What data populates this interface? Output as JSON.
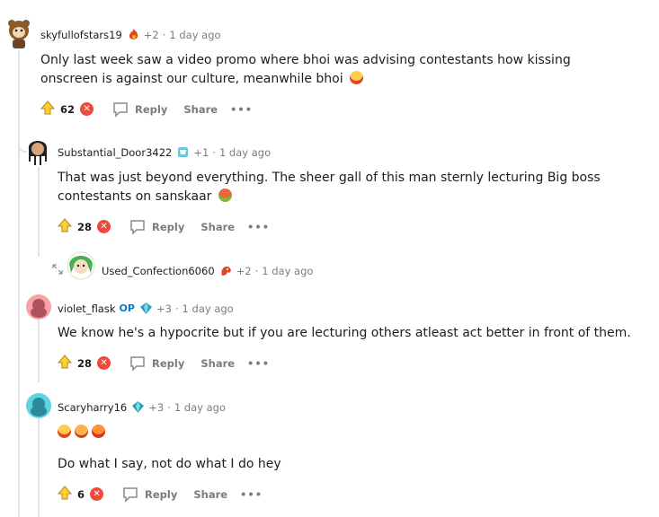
{
  "comments": [
    {
      "username": "skyfullofstars19",
      "award_count": "+2",
      "time": "1 day ago",
      "text": "Only last week saw a video promo where bhoi was advising contestants how kissing onscreen is against our culture, meanwhile bhoi",
      "votes": "62"
    },
    {
      "username": "Substantial_Door3422",
      "award_count": "+1",
      "time": "1 day ago",
      "text": "That was just beyond everything. The sheer gall of this man sternly lecturing Big boss contestants on sanskaar",
      "votes": "28"
    },
    {
      "username": "Used_Confection6060",
      "award_count": "+2",
      "time": "1 day ago"
    },
    {
      "username": "violet_flask",
      "op_label": "OP",
      "award_count": "+3",
      "time": "1 day ago",
      "text": "We know he's a hypocrite but if you are lecturing others atleast act better in front of them.",
      "votes": "28"
    },
    {
      "username": "Scaryharry16",
      "award_count": "+3",
      "time": "1 day ago",
      "text": "Do what I say, not do what I do hey",
      "votes": "6"
    }
  ],
  "labels": {
    "reply": "Reply",
    "share": "Share",
    "more": "•••",
    "sep": "·"
  },
  "colors": {
    "downvote": "#f04a3a",
    "op": "#0079d3",
    "thread_line": "#e0e3e6"
  }
}
